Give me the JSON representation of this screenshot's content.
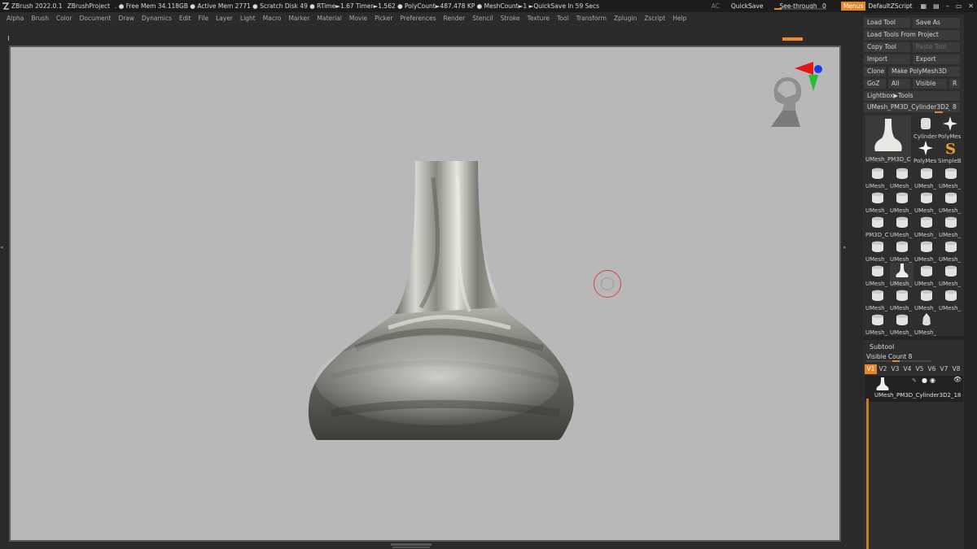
{
  "titlebar": {
    "app": "ZBrush 2022.0.1",
    "project": "ZBrushProject",
    "stats": ". ● Free Mem 34.118GB ● Active Mem 2771 ● Scratch Disk 49 ●  RTime►1.67 Timer►1.562 ● PolyCount►487.478 KP ● MeshCount►1  ►QuickSave In 59 Secs",
    "ac": "AC",
    "quicksave": "QuickSave",
    "see_through_label": "See-through",
    "see_through_value": "0",
    "menus": "Menus",
    "default_script": "DefaultZScript"
  },
  "menubar": [
    "Alpha",
    "Brush",
    "Color",
    "Document",
    "Draw",
    "Dynamics",
    "Edit",
    "File",
    "Layer",
    "Light",
    "Macro",
    "Marker",
    "Material",
    "Movie",
    "Picker",
    "Preferences",
    "Render",
    "Stencil",
    "Stroke",
    "Texture",
    "Tool",
    "Transform",
    "Zplugin",
    "Zscript",
    "Help"
  ],
  "tool_panel": {
    "load_tool": "Load Tool",
    "save_as": "Save As",
    "load_from_project": "Load Tools From Project",
    "copy_tool": "Copy Tool",
    "paste_tool": "Paste Tool",
    "import": "Import",
    "export": "Export",
    "clone": "Clone",
    "make_polymesh": "Make PolyMesh3D",
    "goz": "GoZ",
    "all": "All",
    "visible": "Visible",
    "r": "R",
    "lightbox": "Lightbox▶Tools",
    "current_tool": "UMesh_PM3D_Cylinder3D2_1",
    "current_tool_count": "8",
    "big_thumb_label": "UMesh_PM3D_C",
    "small_tools": [
      "Cylinder",
      "PolyMes",
      "PolyMes",
      "SimpleB"
    ],
    "grid_labels": [
      "UMesh_",
      "UMesh_",
      "UMesh_",
      "UMesh_",
      "UMesh_",
      "UMesh_",
      "UMesh_",
      "UMesh_",
      "PM3D_C",
      "UMesh_",
      "UMesh_",
      "UMesh_",
      "UMesh_",
      "UMesh_",
      "UMesh_",
      "UMesh_",
      "UMesh_",
      "UMesh_",
      "UMesh_",
      "UMesh_",
      "UMesh_",
      "UMesh_",
      "UMesh_",
      "UMesh_",
      "UMesh_",
      "UMesh_",
      "UMesh_"
    ]
  },
  "subtool": {
    "header": "Subtool",
    "visible_count_label": "Visible Count",
    "visible_count": "8",
    "versions": [
      "V1",
      "V2",
      "V3",
      "V4",
      "V5",
      "V6",
      "V7",
      "V8"
    ],
    "active_version": "V1",
    "item_label": "UMesh_PM3D_Cylinder3D2_18"
  },
  "colors": {
    "accent": "#e8852a",
    "canvas": "#b8b8b8",
    "panel": "#2e2e2e"
  }
}
